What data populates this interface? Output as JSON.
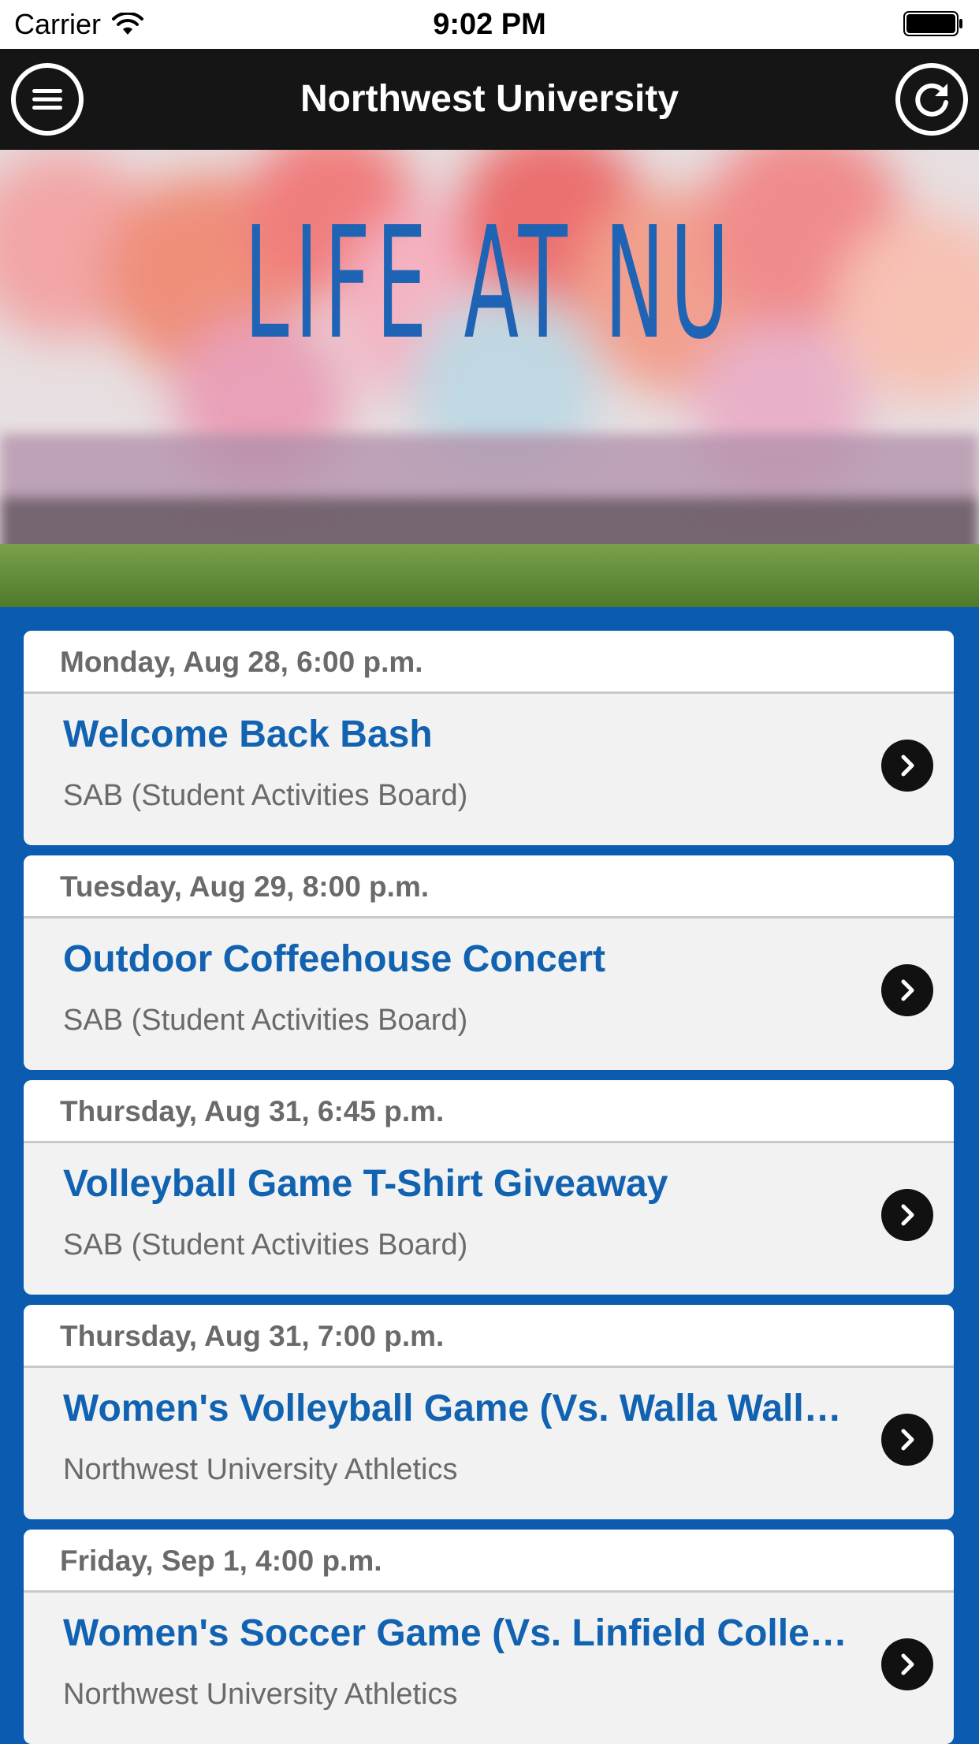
{
  "status_bar": {
    "carrier": "Carrier",
    "time": "9:02 PM"
  },
  "nav": {
    "title": "Northwest University",
    "menu_icon": "hamburger-menu-icon",
    "refresh_icon": "refresh-icon"
  },
  "hero": {
    "title": "LIFE AT NU"
  },
  "colors": {
    "accent_blue": "#0b5bb0",
    "title_blue": "#1162b0",
    "nav_bg": "#151515"
  },
  "events": [
    {
      "date": "Monday, Aug 28, 6:00 p.m.",
      "title": "Welcome Back Bash",
      "org": "SAB (Student Activities Board)"
    },
    {
      "date": "Tuesday, Aug 29, 8:00 p.m.",
      "title": "Outdoor Coffeehouse Concert",
      "org": "SAB (Student Activities Board)"
    },
    {
      "date": "Thursday, Aug 31, 6:45 p.m.",
      "title": "Volleyball Game T-Shirt Giveaway",
      "org": "SAB (Student Activities Board)"
    },
    {
      "date": "Thursday, Aug 31, 7:00 p.m.",
      "title": "Women's Volleyball Game (Vs. Walla Wall…",
      "org": "Northwest University Athletics"
    },
    {
      "date": "Friday, Sep 1, 4:00 p.m.",
      "title": "Women's Soccer Game (Vs. Linfield Colle…",
      "org": "Northwest University Athletics"
    }
  ]
}
